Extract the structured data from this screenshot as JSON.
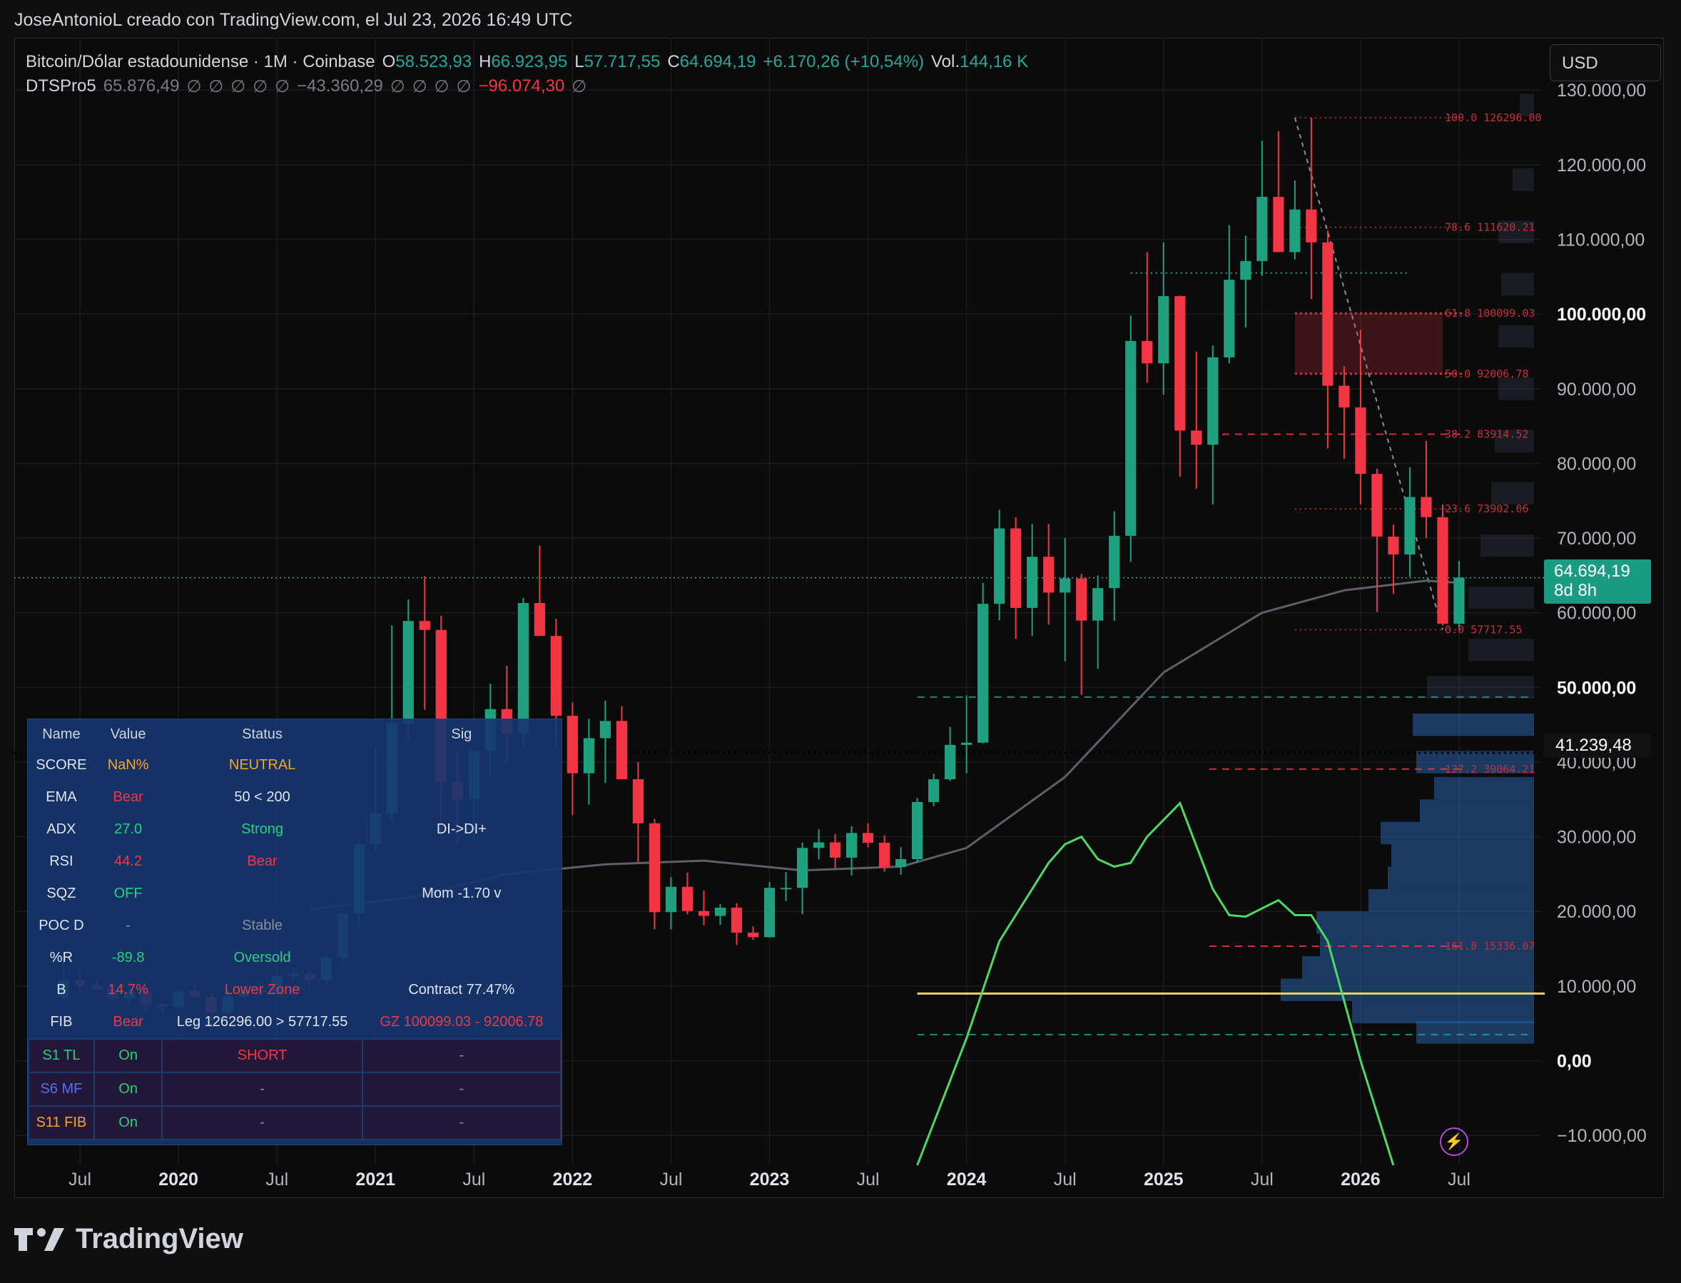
{
  "header": {
    "author_line": "JoseAntonioL creado con TradingView.com, el Jul 23, 2026 16:49 UTC"
  },
  "legend": {
    "symbol": "Bitcoin/Dólar estadounidense · 1M · Coinbase",
    "open_label": "O",
    "open": "58.523,93",
    "high_label": "H",
    "high": "66.923,95",
    "low_label": "L",
    "low": "57.717,55",
    "close_label": "C",
    "close": "64.694,19",
    "change": "+6.170,26 (+10,54%)",
    "vol_label": "Vol.",
    "vol": "144,16 K",
    "indicator_name": "DTSPro5",
    "ind_val1": "65.876,49",
    "ind_val2": "−43.360,29",
    "ind_val3": "−96.074,30",
    "empty_symbol": "∅"
  },
  "currency": "USD",
  "price_tag": {
    "price": "64.694,19",
    "countdown": "8d 8h"
  },
  "level_tag": "41.239,48",
  "status_table": {
    "headers": [
      "Name",
      "Value",
      "Status",
      "Sig"
    ],
    "rows": [
      {
        "name": "SCORE",
        "value": "NaN%",
        "status": "NEUTRAL",
        "sig": "",
        "vc": "orange",
        "sc": "orange"
      },
      {
        "name": "EMA",
        "value": "Bear",
        "status": "50 < 200",
        "sig": "",
        "vc": "red",
        "sc": "white"
      },
      {
        "name": "ADX",
        "value": "27.0",
        "status": "Strong",
        "sig": "DI->DI+",
        "vc": "green",
        "sc": "green"
      },
      {
        "name": "RSI",
        "value": "44.2",
        "status": "Bear",
        "sig": "",
        "vc": "red",
        "sc": "red"
      },
      {
        "name": "SQZ",
        "value": "OFF",
        "status": "",
        "sig": "Mom -1.70 v",
        "vc": "green",
        "sc": "white"
      },
      {
        "name": "POC D",
        "value": "-",
        "status": "Stable",
        "sig": "",
        "vc": "gray",
        "sc": "gray"
      },
      {
        "name": "%R",
        "value": "-89.8",
        "status": "Oversold",
        "sig": "",
        "vc": "green",
        "sc": "green"
      },
      {
        "name": "B",
        "value": "14.7%",
        "status": "Lower Zone",
        "sig": "Contract 77.47%",
        "vc": "red",
        "sc": "red"
      },
      {
        "name": "FIB",
        "value": "Bear",
        "status": "Leg 126296.00 > 57717.55",
        "sig": "GZ 100099.03 - 92006.78",
        "vc": "red",
        "sc": "white"
      }
    ],
    "strategies": [
      {
        "name": "S1 TL",
        "value": "On",
        "status": "SHORT",
        "sig": "-",
        "nc": "green",
        "sc": "red"
      },
      {
        "name": "S6 MF",
        "value": "On",
        "status": "-",
        "sig": "-",
        "nc": "blue",
        "sc": "gray"
      },
      {
        "name": "S11 FIB",
        "value": "On",
        "status": "-",
        "sig": "-",
        "nc": "orange",
        "sc": "gray"
      }
    ]
  },
  "brand": "TradingView",
  "chart_data": {
    "type": "candlestick",
    "symbol": "Bitcoin/Dólar estadounidense",
    "interval": "1M",
    "exchange": "Coinbase",
    "ylim": [
      -14000,
      137000
    ],
    "y_ticks": [
      -10000,
      0,
      10000,
      20000,
      30000,
      40000,
      50000,
      60000,
      70000,
      80000,
      90000,
      100000,
      110000,
      120000,
      130000
    ],
    "y_tick_labels": [
      "−10.000,00",
      "0,00",
      "10.000,00",
      "20.000,00",
      "30.000,00",
      "40.000,00",
      "50.000,00",
      "60.000,00",
      "70.000,00",
      "80.000,00",
      "90.000,00",
      "100.000,00",
      "110.000,00",
      "120.000,00",
      "130.000,00"
    ],
    "y_bold_ticks": [
      0,
      50000,
      100000
    ],
    "x_start": "2019-06",
    "x_range": [
      "2019-03",
      "2026-12"
    ],
    "x_labels": [
      {
        "date": "2019-07",
        "label": "Jul",
        "bold": false
      },
      {
        "date": "2020-01",
        "label": "2020",
        "bold": true
      },
      {
        "date": "2020-07",
        "label": "Jul",
        "bold": false
      },
      {
        "date": "2021-01",
        "label": "2021",
        "bold": true
      },
      {
        "date": "2021-07",
        "label": "Jul",
        "bold": false
      },
      {
        "date": "2022-01",
        "label": "2022",
        "bold": true
      },
      {
        "date": "2022-07",
        "label": "Jul",
        "bold": false
      },
      {
        "date": "2023-01",
        "label": "2023",
        "bold": true
      },
      {
        "date": "2023-07",
        "label": "Jul",
        "bold": false
      },
      {
        "date": "2024-01",
        "label": "2024",
        "bold": true
      },
      {
        "date": "2024-07",
        "label": "Jul",
        "bold": false
      },
      {
        "date": "2025-01",
        "label": "2025",
        "bold": true
      },
      {
        "date": "2025-07",
        "label": "Jul",
        "bold": false
      },
      {
        "date": "2026-01",
        "label": "2026",
        "bold": true
      },
      {
        "date": "2026-07",
        "label": "Jul",
        "bold": false
      }
    ],
    "ohlc": [
      [
        8500,
        13800,
        8200,
        10800
      ],
      [
        10800,
        12200,
        9100,
        10100
      ],
      [
        10100,
        10950,
        9600,
        9600
      ],
      [
        9600,
        10500,
        8000,
        8300
      ],
      [
        8300,
        10400,
        7300,
        9200
      ],
      [
        9200,
        9500,
        6500,
        7550
      ],
      [
        7550,
        7700,
        6500,
        7200
      ],
      [
        7200,
        9600,
        6900,
        9350
      ],
      [
        9350,
        10500,
        8400,
        8550
      ],
      [
        8550,
        9200,
        3850,
        6450
      ],
      [
        6450,
        9500,
        6200,
        8650
      ],
      [
        8650,
        10080,
        8150,
        9450
      ],
      [
        9450,
        10400,
        8850,
        9150
      ],
      [
        9150,
        11450,
        9000,
        11350
      ],
      [
        11350,
        12500,
        10600,
        11650
      ],
      [
        11650,
        12050,
        9900,
        10800
      ],
      [
        10800,
        14100,
        10400,
        13800
      ],
      [
        13800,
        19900,
        13200,
        19700
      ],
      [
        19700,
        29300,
        17600,
        29000
      ],
      [
        29000,
        41900,
        28200,
        33100
      ],
      [
        33100,
        58300,
        32300,
        45200
      ],
      [
        45200,
        61800,
        43000,
        58900
      ],
      [
        58900,
        64900,
        47000,
        57700
      ],
      [
        57700,
        59600,
        30000,
        37300
      ],
      [
        37300,
        41400,
        28800,
        35000
      ],
      [
        35000,
        36700,
        29300,
        41500
      ],
      [
        41500,
        50500,
        38000,
        47100
      ],
      [
        47100,
        52900,
        40000,
        43800
      ],
      [
        43800,
        62000,
        42000,
        61300
      ],
      [
        61300,
        69000,
        57400,
        56900
      ],
      [
        56900,
        59200,
        42000,
        46200
      ],
      [
        46200,
        47990,
        32900,
        38500
      ],
      [
        38500,
        45800,
        34300,
        43200
      ],
      [
        43200,
        48200,
        37200,
        45500
      ],
      [
        45500,
        47500,
        37700,
        37700
      ],
      [
        37700,
        40000,
        26600,
        31800
      ],
      [
        31800,
        32400,
        17600,
        19900
      ],
      [
        19900,
        24600,
        17600,
        23300
      ],
      [
        23300,
        25200,
        19600,
        20050
      ],
      [
        20050,
        22800,
        18150,
        19400
      ],
      [
        19400,
        21000,
        18200,
        20500
      ],
      [
        20500,
        21100,
        15500,
        17150
      ],
      [
        17150,
        18000,
        16200,
        16550
      ],
      [
        16550,
        23950,
        16500,
        23150
      ],
      [
        23150,
        25250,
        21400,
        23150
      ],
      [
        23150,
        29200,
        19600,
        28500
      ],
      [
        28500,
        31000,
        26950,
        29250
      ],
      [
        29250,
        30350,
        25800,
        27200
      ],
      [
        27200,
        31400,
        24800,
        30500
      ],
      [
        30500,
        31800,
        28600,
        29200
      ],
      [
        29200,
        30200,
        25300,
        25950
      ],
      [
        25950,
        28600,
        24900,
        27000
      ],
      [
        27000,
        35200,
        26500,
        34650
      ],
      [
        34650,
        38450,
        34100,
        37700
      ],
      [
        37700,
        44700,
        37500,
        42300
      ],
      [
        42300,
        48950,
        38500,
        42600
      ],
      [
        42600,
        64000,
        42500,
        61200
      ],
      [
        61200,
        73800,
        59000,
        71300
      ],
      [
        71300,
        72800,
        56500,
        60650
      ],
      [
        60650,
        71900,
        56900,
        67500
      ],
      [
        67500,
        71900,
        58400,
        62700
      ],
      [
        62700,
        70000,
        53500,
        64600
      ],
      [
        64600,
        65200,
        49000,
        58950
      ],
      [
        58950,
        65000,
        52500,
        63300
      ],
      [
        63300,
        73600,
        58900,
        70300
      ],
      [
        70300,
        99800,
        66800,
        96400
      ],
      [
        96400,
        108300,
        90800,
        93400
      ],
      [
        93400,
        109600,
        89200,
        102400
      ],
      [
        102400,
        102500,
        78200,
        84400
      ],
      [
        84400,
        95000,
        76600,
        82500
      ],
      [
        82500,
        95800,
        74500,
        94200
      ],
      [
        94200,
        111900,
        93400,
        104600
      ],
      [
        104600,
        110500,
        98200,
        107100
      ],
      [
        107100,
        123200,
        105100,
        115700
      ],
      [
        115700,
        124500,
        108800,
        108300
      ],
      [
        108300,
        117900,
        107300,
        114000
      ],
      [
        114000,
        126296,
        102000,
        109600
      ],
      [
        109600,
        111200,
        82000,
        90400
      ],
      [
        90400,
        93000,
        80600,
        87500
      ],
      [
        87500,
        97900,
        74500,
        78600
      ],
      [
        78600,
        79300,
        60100,
        70200
      ],
      [
        70200,
        71800,
        62500,
        67800
      ],
      [
        67800,
        79500,
        64800,
        75500
      ],
      [
        75500,
        83000,
        70000,
        72800
      ],
      [
        72800,
        74500,
        58300,
        58524
      ],
      [
        58523.93,
        66923.95,
        57717.55,
        64694.19
      ]
    ],
    "ma_line": [
      [
        "2020-09",
        20300
      ],
      [
        "2021-03",
        21800
      ],
      [
        "2021-09",
        25000
      ],
      [
        "2022-03",
        26300
      ],
      [
        "2022-09",
        26800
      ],
      [
        "2023-03",
        25500
      ],
      [
        "2023-09",
        26000
      ],
      [
        "2024-01",
        28500
      ],
      [
        "2024-07",
        38000
      ],
      [
        "2025-01",
        52000
      ],
      [
        "2025-07",
        60000
      ],
      [
        "2025-12",
        63000
      ],
      [
        "2026-05",
        64300
      ],
      [
        "2026-07",
        64000
      ]
    ],
    "indicator_line": [
      [
        "2023-10",
        -14000
      ],
      [
        "2024-01",
        3000
      ],
      [
        "2024-03",
        16000
      ],
      [
        "2024-06",
        26500
      ],
      [
        "2024-07",
        29000
      ],
      [
        "2024-08",
        30000
      ],
      [
        "2024-09",
        27000
      ],
      [
        "2024-10",
        26000
      ],
      [
        "2024-11",
        26500
      ],
      [
        "2024-12",
        30000
      ],
      [
        "2025-02",
        34500
      ],
      [
        "2025-04",
        23000
      ],
      [
        "2025-05",
        19500
      ],
      [
        "2025-06",
        19300
      ],
      [
        "2025-08",
        21500
      ],
      [
        "2025-09",
        19500
      ],
      [
        "2025-10",
        19500
      ],
      [
        "2025-11",
        16000
      ],
      [
        "2026-01",
        0
      ],
      [
        "2026-03",
        -14000
      ]
    ],
    "fib_levels": [
      {
        "label": "100.0",
        "value": 126296.0,
        "value_text": "126296.00",
        "style": "dotted"
      },
      {
        "label": "78.6",
        "value": 111620.21,
        "value_text": "111620.21",
        "style": "dotted"
      },
      {
        "label": "61.8",
        "value": 100099.03,
        "value_text": "100099.03",
        "style": "dotted-bold"
      },
      {
        "label": "50.0",
        "value": 92006.78,
        "value_text": "92006.78",
        "style": "dotted-bold"
      },
      {
        "label": "38.2",
        "value": 83914.52,
        "value_text": "83914.52",
        "style": "dashed"
      },
      {
        "label": "23.6",
        "value": 73902.06,
        "value_text": "73902.06",
        "style": "dotted"
      },
      {
        "label": "0.0",
        "value": 57717.55,
        "value_text": "57717.55",
        "style": "dotted"
      },
      {
        "label": "127.2",
        "value": 39064.21,
        "value_text": "39064.21",
        "style": "dashed"
      },
      {
        "label": "161.8",
        "value": 15336.07,
        "value_text": "15336.07",
        "style": "dashed"
      }
    ],
    "fib_start": "2025-09",
    "golden_zone": {
      "from": "2025-09",
      "to": "2026-06",
      "low": 92006.78,
      "high": 100099.03
    },
    "fib_diag": [
      [
        "2025-09",
        126296
      ],
      [
        "2026-06",
        57717.55
      ]
    ],
    "green_dashed_levels": [
      {
        "value": 48700,
        "from": "2023-10"
      },
      {
        "value": 3500,
        "from": "2023-10"
      }
    ],
    "teal_dotted_level": {
      "value": 105500,
      "from": "2024-11",
      "to": "2026-04"
    },
    "yellow_level": {
      "value": 9000,
      "from": "2023-10"
    },
    "current_price_line": 64694.19,
    "black_dotted_level": 41239.48,
    "volume_profile": [
      [
        128000,
        20
      ],
      [
        118000,
        30
      ],
      [
        111000,
        50
      ],
      [
        104000,
        46
      ],
      [
        97000,
        50
      ],
      [
        90000,
        50
      ],
      [
        83000,
        55
      ],
      [
        76000,
        60
      ],
      [
        69000,
        75
      ],
      [
        62000,
        92
      ],
      [
        55000,
        92
      ],
      [
        50000,
        150
      ],
      [
        45000,
        170
      ],
      [
        40000,
        165
      ],
      [
        36500,
        140
      ],
      [
        33500,
        160
      ],
      [
        30500,
        215
      ],
      [
        27500,
        200
      ],
      [
        24500,
        205
      ],
      [
        21500,
        232
      ],
      [
        18500,
        305
      ],
      [
        15500,
        300
      ],
      [
        12500,
        325
      ],
      [
        9500,
        355
      ],
      [
        6500,
        255
      ],
      [
        3800,
        165
      ]
    ]
  }
}
